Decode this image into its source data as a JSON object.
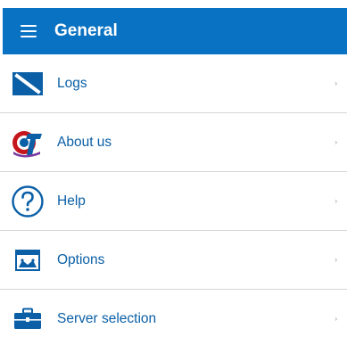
{
  "app_bar": {
    "title": "General",
    "menu_icon": "hamburger-menu-icon",
    "background": "#0a72c2"
  },
  "items": [
    {
      "label": "Logs",
      "icon": "logs-icon"
    },
    {
      "label": "About us",
      "icon": "company-logo-icon"
    },
    {
      "label": "Help",
      "icon": "question-circle-icon"
    },
    {
      "label": "Options",
      "icon": "options-icon"
    },
    {
      "label": "Server selection",
      "icon": "briefcase-icon"
    }
  ],
  "chevron": "›",
  "colors": {
    "accent": "#0a72c2",
    "label_text": "#0a5fa6",
    "divider": "#d6d6d6"
  }
}
